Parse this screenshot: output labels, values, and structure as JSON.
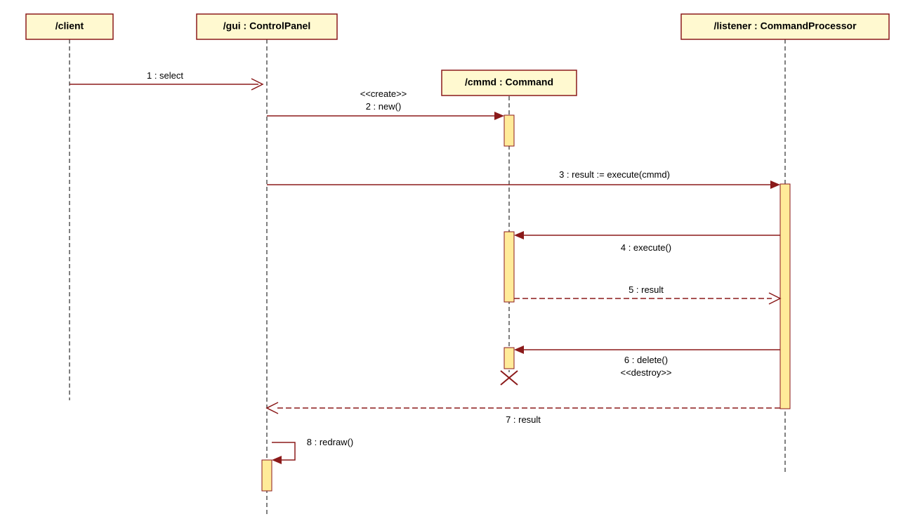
{
  "diagram_type": "UML Sequence Diagram",
  "participants": {
    "client": {
      "label": "/client"
    },
    "gui": {
      "label": "/gui : ControlPanel"
    },
    "cmmd": {
      "label": "/cmmd : Command"
    },
    "listener": {
      "label": "/listener : CommandProcessor"
    }
  },
  "messages": {
    "msg1": {
      "text": "1 : select"
    },
    "msg2_stereo": {
      "text": "<<create>>"
    },
    "msg2": {
      "text": "2 : new()"
    },
    "msg3": {
      "text": "3 : result := execute(cmmd)"
    },
    "msg4": {
      "text": "4 : execute()"
    },
    "msg5": {
      "text": "5 : result"
    },
    "msg6": {
      "text": "6 : delete()"
    },
    "msg6_stereo": {
      "text": "<<destroy>>"
    },
    "msg7": {
      "text": "7 : result"
    },
    "msg8": {
      "text": "8 : redraw()"
    }
  }
}
